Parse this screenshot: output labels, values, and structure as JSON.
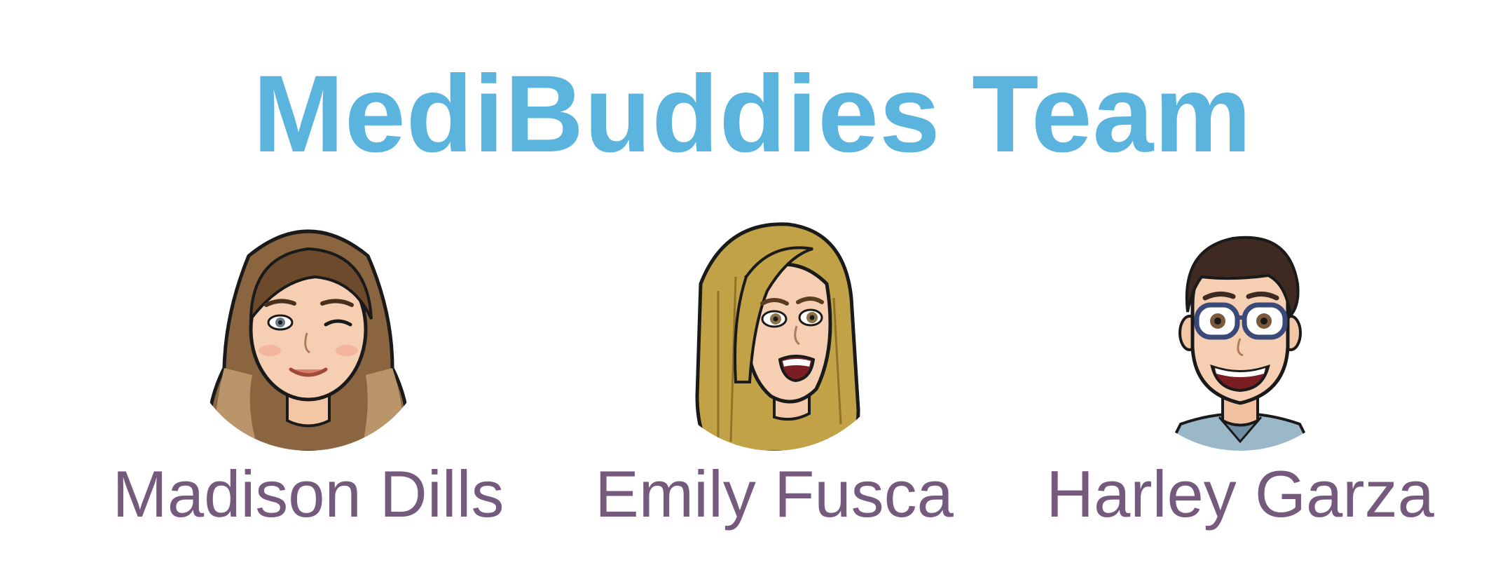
{
  "title": "MediBuddies Team",
  "colors": {
    "title": "#5ab4de",
    "name": "#765a7d"
  },
  "members": [
    {
      "name": "Madison Dills",
      "avatar_icon": "bitmoji-woman-brown-hair-winking"
    },
    {
      "name": "Emily Fusca",
      "avatar_icon": "bitmoji-woman-blonde-hair-surprised"
    },
    {
      "name": "Harley Garza",
      "avatar_icon": "bitmoji-man-glasses-smiling"
    }
  ]
}
